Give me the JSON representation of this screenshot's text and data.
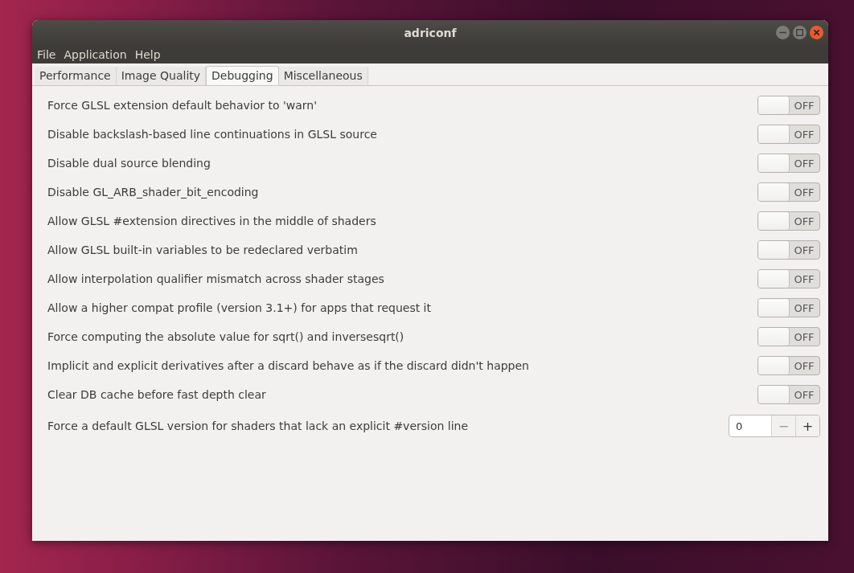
{
  "window": {
    "title": "adriconf"
  },
  "menu": [
    "File",
    "Application",
    "Help"
  ],
  "tabs": [
    {
      "label": "Performance",
      "selected": false
    },
    {
      "label": "Image Quality",
      "selected": false
    },
    {
      "label": "Debugging",
      "selected": true
    },
    {
      "label": "Miscellaneous",
      "selected": false
    }
  ],
  "options": [
    {
      "kind": "switch",
      "label": "Force GLSL extension default behavior to 'warn'",
      "on": false,
      "state_text": "OFF"
    },
    {
      "kind": "switch",
      "label": "Disable backslash-based line continuations in GLSL source",
      "on": false,
      "state_text": "OFF"
    },
    {
      "kind": "switch",
      "label": "Disable dual source blending",
      "on": false,
      "state_text": "OFF"
    },
    {
      "kind": "switch",
      "label": "Disable GL_ARB_shader_bit_encoding",
      "on": false,
      "state_text": "OFF"
    },
    {
      "kind": "switch",
      "label": "Allow GLSL #extension directives in the middle of shaders",
      "on": false,
      "state_text": "OFF"
    },
    {
      "kind": "switch",
      "label": "Allow GLSL built-in variables to be redeclared verbatim",
      "on": false,
      "state_text": "OFF"
    },
    {
      "kind": "switch",
      "label": "Allow interpolation qualifier mismatch across shader stages",
      "on": false,
      "state_text": "OFF"
    },
    {
      "kind": "switch",
      "label": "Allow a higher compat profile (version 3.1+) for apps that request it",
      "on": false,
      "state_text": "OFF"
    },
    {
      "kind": "switch",
      "label": "Force computing the absolute value for sqrt() and inversesqrt()",
      "on": false,
      "state_text": "OFF"
    },
    {
      "kind": "switch",
      "label": "Implicit and explicit derivatives after a discard behave as if the discard didn't happen",
      "on": false,
      "state_text": "OFF"
    },
    {
      "kind": "switch",
      "label": "Clear DB cache before fast depth clear",
      "on": false,
      "state_text": "OFF"
    },
    {
      "kind": "spin",
      "label": "Force a default GLSL version for shaders that lack an explicit #version line",
      "value": "0",
      "minus": "−",
      "plus": "+"
    }
  ]
}
